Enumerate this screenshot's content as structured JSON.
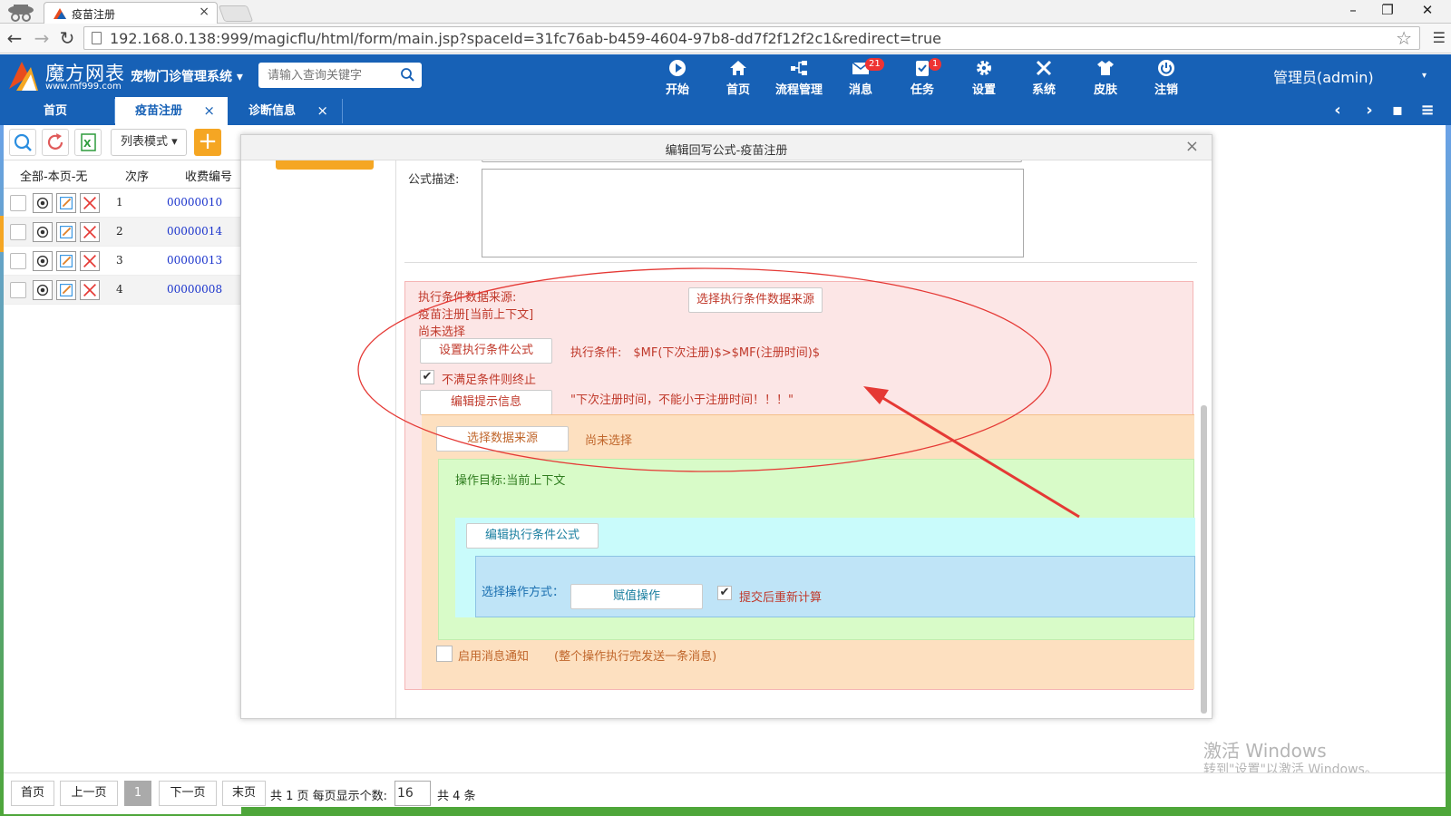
{
  "browser": {
    "tab_title": "疫苗注册",
    "url": "192.168.0.138:999/magicflu/html/form/main.jsp?spaceId=31fc76ab-b459-4604-97b8-dd7f2f12f2c1&redirect=true",
    "tab_close": "×",
    "minimize": "–",
    "restore": "❐",
    "close": "✕",
    "back": "←",
    "forward": "→",
    "reload": "↻",
    "bookmark": "☆",
    "menu": "☰"
  },
  "app": {
    "logo_name": "魔方网表",
    "logo_url": "www.mf999.com",
    "system_name": "宠物门诊管理系统 ▾",
    "search_placeholder": "请输入查询关键字",
    "user": "管理员(admin)",
    "user_caret": "▾",
    "nav": [
      {
        "label": "开始",
        "icon": "play-icon"
      },
      {
        "label": "首页",
        "icon": "home-icon"
      },
      {
        "label": "流程管理",
        "icon": "flow-icon"
      },
      {
        "label": "消息",
        "icon": "mail-icon",
        "badge": "21"
      },
      {
        "label": "任务",
        "icon": "task-icon",
        "badge": "1"
      },
      {
        "label": "设置",
        "icon": "gear-icon"
      },
      {
        "label": "系统",
        "icon": "tools-icon"
      },
      {
        "label": "皮肤",
        "icon": "shirt-icon"
      },
      {
        "label": "注销",
        "icon": "power-icon"
      }
    ]
  },
  "tabs": {
    "items": [
      {
        "label": "首页"
      },
      {
        "label": "疫苗注册",
        "close": "×"
      },
      {
        "label": "诊断信息",
        "close": "×"
      }
    ],
    "prev": "‹",
    "next": "›",
    "save": "▪",
    "more": "≡"
  },
  "list": {
    "mode": "列表模式 ▾",
    "add": "+",
    "head_select": "全部-本页-无",
    "head_seq": "次序",
    "head_code": "收费编号",
    "rows": [
      {
        "seq": "1",
        "code": "00000010"
      },
      {
        "seq": "2",
        "code": "00000014"
      },
      {
        "seq": "3",
        "code": "00000013"
      },
      {
        "seq": "4",
        "code": "00000008"
      }
    ]
  },
  "pager": {
    "first": "首页",
    "prev": "上一页",
    "current": "1",
    "next": "下一页",
    "last": "末页",
    "summary": "共 1 页 每页显示个数:",
    "page_size": "16",
    "total": "共 4 条"
  },
  "watermark": {
    "line1": "激活 Windows",
    "line2": "转到\"设置\"以激活 Windows。"
  },
  "modal": {
    "title": "编辑回写公式-疫苗注册",
    "close": "×",
    "desc_label": "公式描述:",
    "condition_source_label": "执行条件数据来源:",
    "condition_source_value": "疫苗注册[当前上下文]",
    "condition_source_status": "尚未选择",
    "select_condition_source_btn": "选择执行条件数据来源",
    "set_condition_formula_btn": "设置执行条件公式",
    "condition_text": "执行条件:　$MF(下次注册)$>$MF(注册时间)$",
    "stop_if_unsatisfied": "不满足条件则终止",
    "stop_checked": "✔",
    "edit_tip_btn": "编辑提示信息",
    "tip_text": "\"下次注册时间，不能小于注册时间！！！\"",
    "select_data_source_btn": "选择数据来源",
    "data_source_status": "尚未选择",
    "target_text": "操作目标:当前上下文",
    "edit_exec_formula_btn": "编辑执行条件公式",
    "op_mode_label": "选择操作方式：",
    "assign_btn": "赋值操作",
    "recalc_checked": "✔",
    "recalc_label": "提交后重新计算",
    "notify_label": "启用消息通知",
    "notify_note": "(整个操作执行完发送一条消息)"
  },
  "colors": {
    "header_blue": "#1761b6",
    "accent_orange": "#f5a623",
    "annotation_red": "#e53935"
  }
}
